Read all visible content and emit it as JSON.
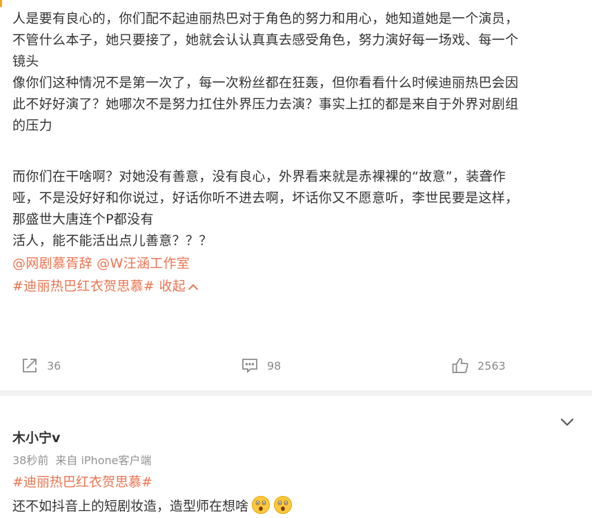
{
  "post": {
    "paragraphs": [
      "人是要有良心的，你们配不起迪丽热巴对于角色的努力和用心，她知道她是一个演员，",
      "不管什么本子，她只要接了，她就会认认真真去感受角色，努力演好每一场戏、每一个",
      "镜头",
      "像你们这种情况不是第一次了，每一次粉丝都在狂轰，但你看看什么时候迪丽热巴会因",
      "此不好好演了？她哪次不是努力扛住外界压力去演？事实上扛的都是来自于外界对剧组",
      "的压力"
    ],
    "paragraphs2": [
      "而你们在干啥啊？对她没有善意，没有良心，外界看来就是赤裸裸的“故意”，装聋作",
      "哑，不是没好好和你说过，好话你听不进去啊，坏话你又不愿意听，李世民要是这样，",
      "那盛世大唐连个P都没有",
      "活人，能不能活出点儿善意？？？"
    ],
    "mention_1": "@网剧慕胥辞",
    "mention_2": "@W汪涵工作室",
    "hashtag": "#迪丽热巴红衣贺思慕#",
    "collapse_label": "收起",
    "accent_color": "#eb7350"
  },
  "actions": {
    "share_icon": "share-icon",
    "share_count": "36",
    "comment_icon": "comment-icon",
    "comment_count": "98",
    "like_icon": "thumbs-up-icon",
    "like_count": "2563"
  },
  "comment": {
    "username": "木小宁v",
    "time": "38秒前",
    "source": "来自 iPhone客户端",
    "hashtag": "#迪丽热巴红衣贺思慕#",
    "text": "还不如抖音上的短剧妆造，造型师在想啥",
    "emoji": "astonished-face-emoji"
  }
}
